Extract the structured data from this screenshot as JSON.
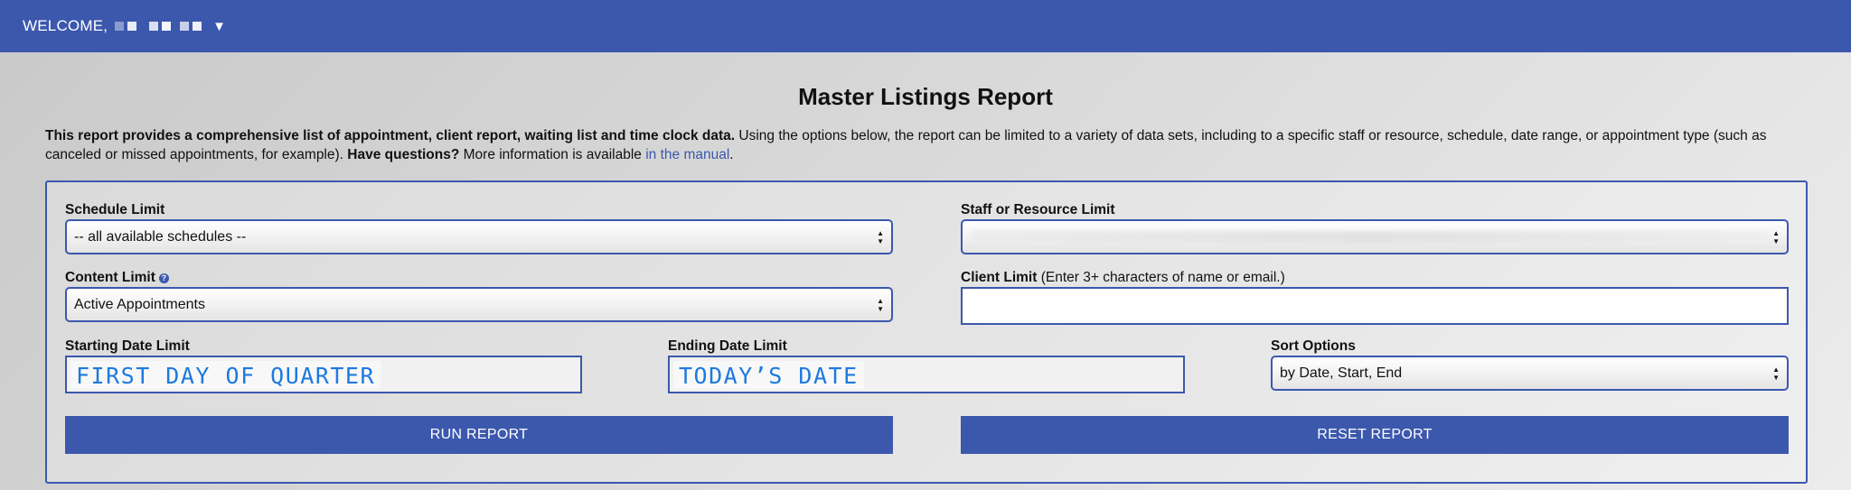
{
  "topbar": {
    "welcome_label": "WELCOME,",
    "caret": "▼"
  },
  "page": {
    "title": "Master Listings Report"
  },
  "intro": {
    "bold_lead": "This report provides a comprehensive list of appointment, client report, waiting list and time clock data.",
    "body": " Using the options below, the report can be limited to a variety of data sets, including to a specific staff or resource, schedule, date range, or appointment type (such as canceled or missed appointments, for example). ",
    "questions_bold": "Have questions?",
    "more_info": " More information is available ",
    "manual_link": "in the manual",
    "end": "."
  },
  "form": {
    "schedule_limit": {
      "label": "Schedule Limit",
      "value": "-- all available schedules --"
    },
    "staff_limit": {
      "label": "Staff or Resource Limit",
      "value": ""
    },
    "content_limit": {
      "label": "Content Limit",
      "help": "?",
      "value": "Active Appointments"
    },
    "client_limit": {
      "label": "Client Limit",
      "note": " (Enter 3+ characters of name or email.)",
      "value": ""
    },
    "start_date": {
      "label": "Starting Date Limit",
      "value": "FIRST DAY OF QUARTER"
    },
    "end_date": {
      "label": "Ending Date Limit",
      "value": "TODAY’S DATE"
    },
    "sort_options": {
      "label": "Sort Options",
      "value": "by Date, Start, End"
    },
    "run_button": "RUN REPORT",
    "reset_button": "RESET REPORT"
  },
  "colors": {
    "brand": "#3c58ad",
    "date_text": "#1d7ae0"
  }
}
